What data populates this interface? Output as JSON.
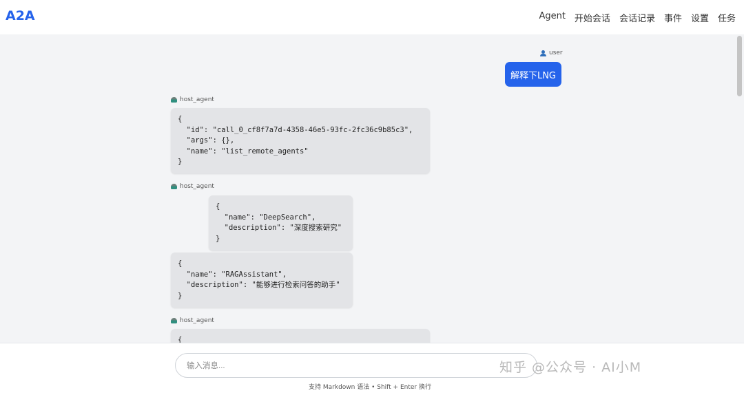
{
  "app": {
    "title": "A2A"
  },
  "nav": {
    "items": [
      "Agent",
      "开始会话",
      "会话记录",
      "事件",
      "设置",
      "任务"
    ]
  },
  "chat": {
    "user_message": {
      "sender": "user",
      "text": "解释下LNG"
    },
    "agent_blocks": [
      {
        "sender": "host_agent",
        "cards": [
          "{\n  \"id\": \"call_0_cf8f7a7d-4358-46e5-93fc-2fc36c9b85c3\",\n  \"args\": {},\n  \"name\": \"list_remote_agents\"\n}"
        ]
      },
      {
        "sender": "host_agent",
        "cards": [
          "{\n  \"name\": \"DeepSearch\",\n  \"description\": \"深度搜索研究\"\n}",
          "{\n  \"name\": \"RAGAssistant\",\n  \"description\": \"能够进行检索问答的助手\"\n}"
        ]
      },
      {
        "sender": "host_agent",
        "cards": [
          "{"
        ]
      }
    ]
  },
  "composer": {
    "placeholder": "输入消息...",
    "hint": "支持 Markdown 语法 • Shift + Enter 换行"
  },
  "watermark": "知乎 @公众号 · AI小M",
  "colors": {
    "accent": "#2563eb",
    "card_bg": "#e3e4e7",
    "page_bg": "#f3f4f6"
  },
  "icons": {
    "user": "user-icon",
    "agent": "bot-icon"
  }
}
